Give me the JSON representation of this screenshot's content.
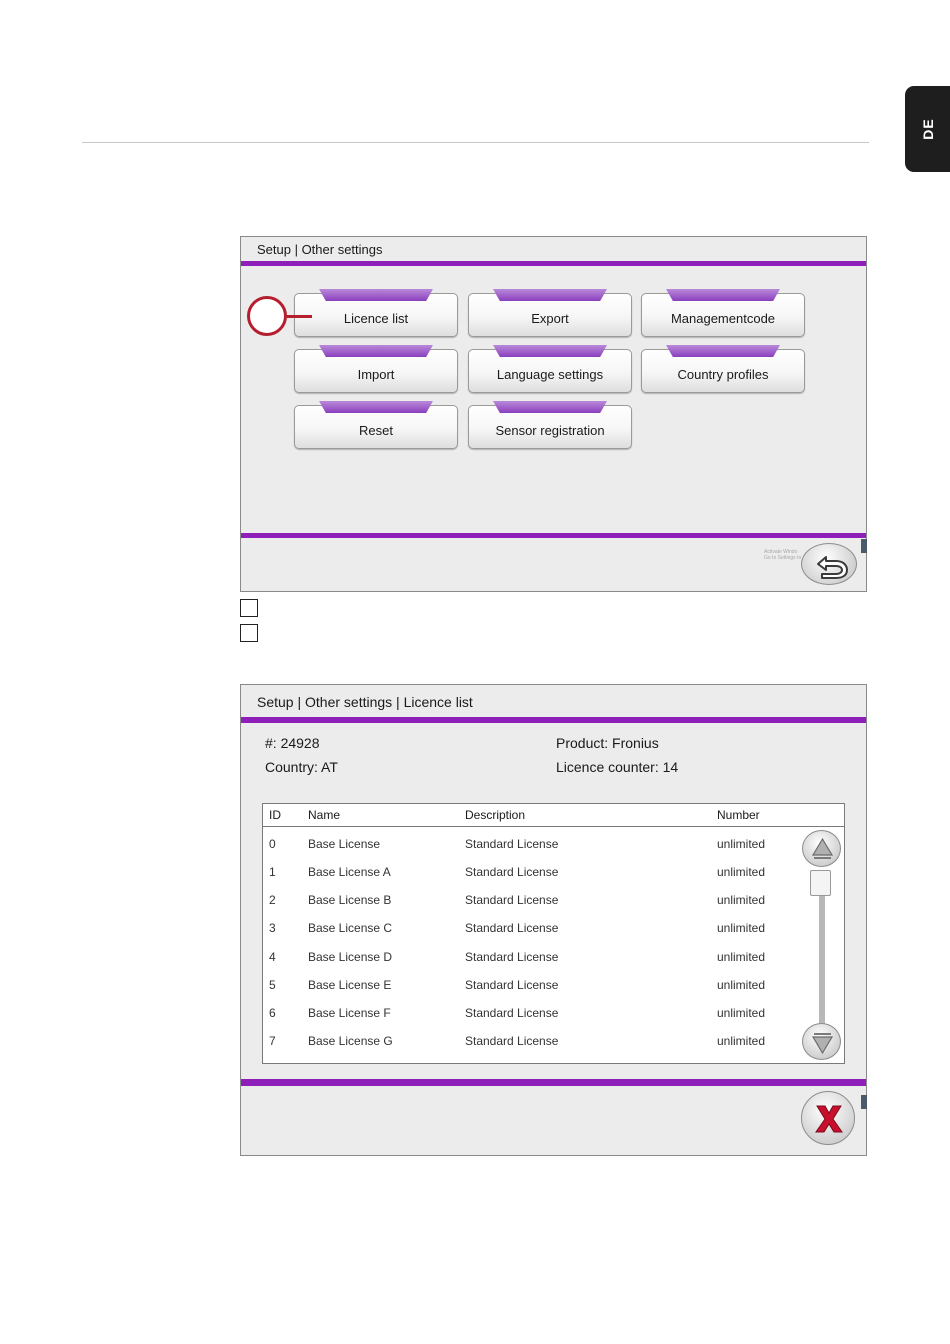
{
  "side_tab": {
    "label": "DE"
  },
  "screen1": {
    "breadcrumb": "Setup | Other settings",
    "buttons": [
      {
        "label": "Licence list"
      },
      {
        "label": "Export"
      },
      {
        "label": "Managementcode"
      },
      {
        "label": "Import"
      },
      {
        "label": "Language settings"
      },
      {
        "label": "Country profiles"
      },
      {
        "label": "Reset"
      },
      {
        "label": "Sensor registration"
      }
    ],
    "watermark": [
      "Activate Windo",
      "Go to Settings to"
    ]
  },
  "screen2": {
    "breadcrumb": "Setup | Other settings | Licence list",
    "info": {
      "serial": "#: 24928",
      "country": "Country: AT",
      "product": "Product: Fronius",
      "licence_counter": "Licence counter: 14"
    },
    "table": {
      "headers": [
        "ID",
        "Name",
        "Description",
        "Number"
      ],
      "rows": [
        [
          "0",
          "Base License",
          "Standard License",
          "unlimited"
        ],
        [
          "1",
          "Base License A",
          "Standard License",
          "unlimited"
        ],
        [
          "2",
          "Base License B",
          "Standard License",
          "unlimited"
        ],
        [
          "3",
          "Base License C",
          "Standard License",
          "unlimited"
        ],
        [
          "4",
          "Base License D",
          "Standard License",
          "unlimited"
        ],
        [
          "5",
          "Base License E",
          "Standard License",
          "unlimited"
        ],
        [
          "6",
          "Base License F",
          "Standard License",
          "unlimited"
        ],
        [
          "7",
          "Base License G",
          "Standard License",
          "unlimited"
        ]
      ]
    }
  },
  "colors": {
    "accent": "#8e1fb8",
    "callout": "#b51e2d",
    "close": "#c8102e"
  },
  "icons": {
    "back": "back-arrow-icon",
    "close": "close-x-icon",
    "up": "scroll-up-icon",
    "down": "scroll-down-icon"
  }
}
